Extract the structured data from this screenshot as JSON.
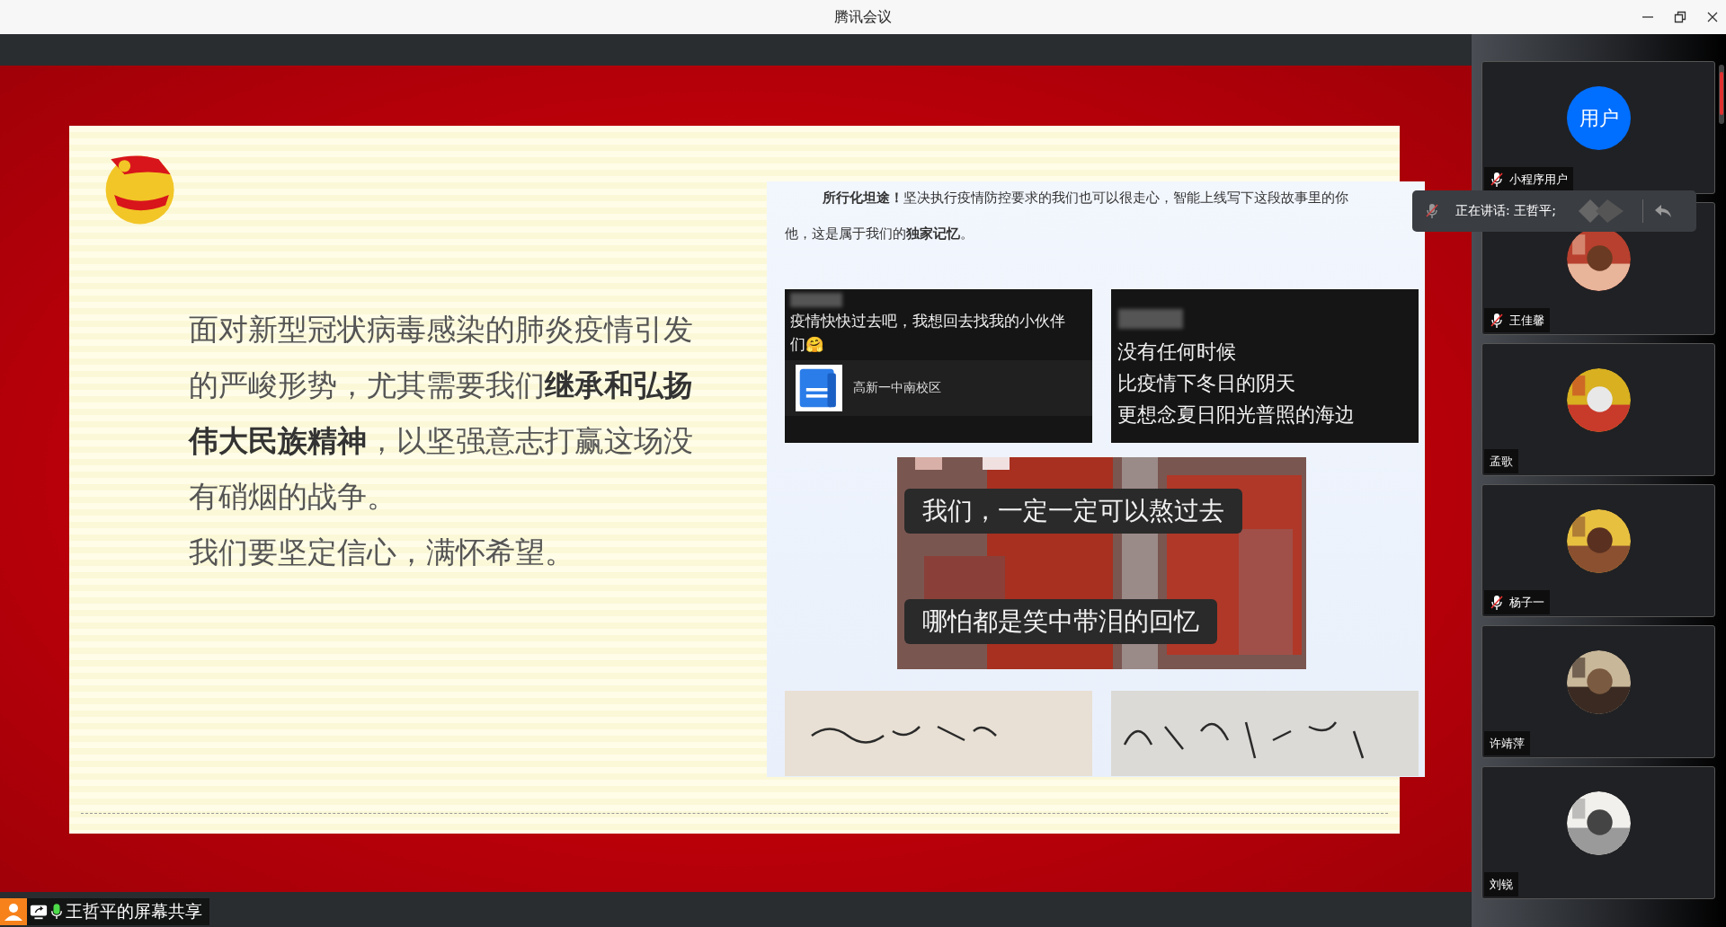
{
  "window": {
    "title": "腾讯会议"
  },
  "slide": {
    "paragraphs": [
      "面对新型冠状病毒感染的肺炎疫情引发的严峻形势，尤其需要我们**继承和弘扬伟大民族精神**，以坚强意志打赢这场没有硝烟的战争。",
      "我们要坚定信心，满怀希望。"
    ],
    "article_lines": [
      "**所行化坦途！**坚决执行疫情防控要求的我们也可以很走心，智能上线写下这段故事里的你",
      "他，这是属于我们的**独家记忆**。"
    ],
    "chat_cards": [
      {
        "kind": "link",
        "text": "疫情快快过去吧，我想回去找我的小伙伴们🤗",
        "link_title": "高新一中南校区"
      },
      {
        "kind": "lines",
        "lines": [
          "没有任何时候",
          "比疫情下冬日的阴天",
          "更想念夏日阳光普照的海边"
        ]
      }
    ],
    "video_captions": [
      "我们，一定一定可以熬过去",
      "哪怕都是笑中带泪的回忆"
    ],
    "photos": [
      {
        "kind": "picture"
      },
      {
        "kind": "picture"
      }
    ]
  },
  "speaking": {
    "text": "正在讲话: 王哲平;",
    "muted": true
  },
  "participants": [
    {
      "name": "小程序用户",
      "muted": true,
      "avatar": {
        "kind": "text",
        "text": "用户"
      }
    },
    {
      "name": "王佳馨",
      "muted": true,
      "avatar": {
        "kind": "picture"
      }
    },
    {
      "name": "孟歌",
      "muted": false,
      "avatar": {
        "kind": "picture"
      }
    },
    {
      "name": "杨子一",
      "muted": true,
      "avatar": {
        "kind": "picture"
      }
    },
    {
      "name": "许靖萍",
      "muted": false,
      "avatar": {
        "kind": "picture"
      }
    },
    {
      "name": "刘锐",
      "muted": false,
      "avatar": {
        "kind": "picture"
      }
    }
  ],
  "share_bar": {
    "label": "王哲平的屏幕共享"
  }
}
